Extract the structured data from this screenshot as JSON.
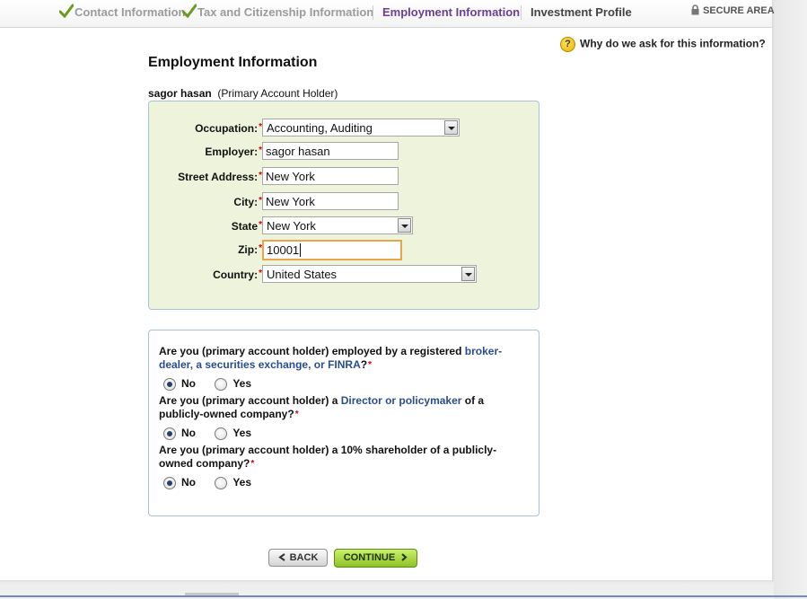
{
  "steps": {
    "contact": "Contact Information",
    "tax": "Tax and Citizenship Information",
    "employment": "Employment Information",
    "investment": "Investment Profile"
  },
  "secure_area": "SECURE AREA",
  "help": {
    "icon": "?",
    "text": "Why do we ask for this information?"
  },
  "page_title": "Employment Information",
  "holder": {
    "name": "sagor hasan",
    "role": "(Primary Account Holder)"
  },
  "form": {
    "occupation": {
      "label": "Occupation:",
      "value": "Accounting, Auditing"
    },
    "employer": {
      "label": "Employer:",
      "value": "sagor hasan"
    },
    "street": {
      "label": "Street Address:",
      "value": "New York"
    },
    "city": {
      "label": "City:",
      "value": "New York"
    },
    "state": {
      "label": "State",
      "value": "New York"
    },
    "zip": {
      "label": "Zip:",
      "value": "10001"
    },
    "country": {
      "label": "Country:",
      "value": "United States"
    },
    "required_mark": "*"
  },
  "questions": {
    "q1": {
      "pre": "Are you (primary account holder) employed by a registered ",
      "link": "broker-dealer, a securities exchange, or FINRA",
      "post": "?"
    },
    "q2": {
      "pre": "Are you (primary account holder) a ",
      "link": "Director or policymaker",
      "post": " of a publicly-owned company?"
    },
    "q3": {
      "pre": "Are you (primary account holder) a 10% shareholder of a publicly-owned company?",
      "link": "",
      "post": ""
    },
    "no": "No",
    "yes": "Yes",
    "selected": [
      "No",
      "No",
      "No"
    ]
  },
  "buttons": {
    "back": "BACK",
    "continue": "CONTINUE"
  }
}
